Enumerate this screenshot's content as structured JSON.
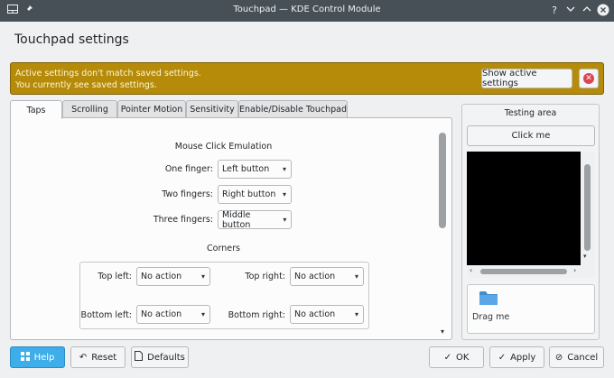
{
  "window": {
    "title": "Touchpad — KDE Control Module",
    "icons": [
      "app-icon",
      "pin-icon",
      "help-icon",
      "minimize-icon",
      "maximize-icon",
      "close-icon"
    ]
  },
  "page_title": "Touchpad settings",
  "banner": {
    "line1": "Active settings don't match saved settings.",
    "line2": "You currently see saved settings.",
    "show_active_label": "Show active settings",
    "color": "#b68b0a"
  },
  "tabs": [
    {
      "label": "Taps"
    },
    {
      "label": "Scrolling"
    },
    {
      "label": "Pointer Motion"
    },
    {
      "label": "Sensitivity"
    },
    {
      "label": "Enable/Disable Touchpad"
    }
  ],
  "taps": {
    "mouse_click_title": "Mouse Click Emulation",
    "one_finger_label": "One finger:",
    "one_finger_value": "Left button",
    "two_fingers_label": "Two fingers:",
    "two_fingers_value": "Right button",
    "three_fingers_label": "Three fingers:",
    "three_fingers_value": "Middle button",
    "corners_title": "Corners",
    "top_left_label": "Top left:",
    "top_left_value": "No action",
    "top_right_label": "Top right:",
    "top_right_value": "No action",
    "bottom_left_label": "Bottom left:",
    "bottom_left_value": "No action",
    "bottom_right_label": "Bottom right:",
    "bottom_right_value": "No action"
  },
  "testing": {
    "title": "Testing area",
    "click_me_label": "Click me",
    "drag_me_label": "Drag me"
  },
  "buttons": {
    "help": "Help",
    "reset": "Reset",
    "defaults": "Defaults",
    "ok": "OK",
    "apply": "Apply",
    "cancel": "Cancel"
  },
  "colors": {
    "accent": "#3daee9",
    "titlebar": "#475057",
    "close_dot": "#da4453"
  }
}
